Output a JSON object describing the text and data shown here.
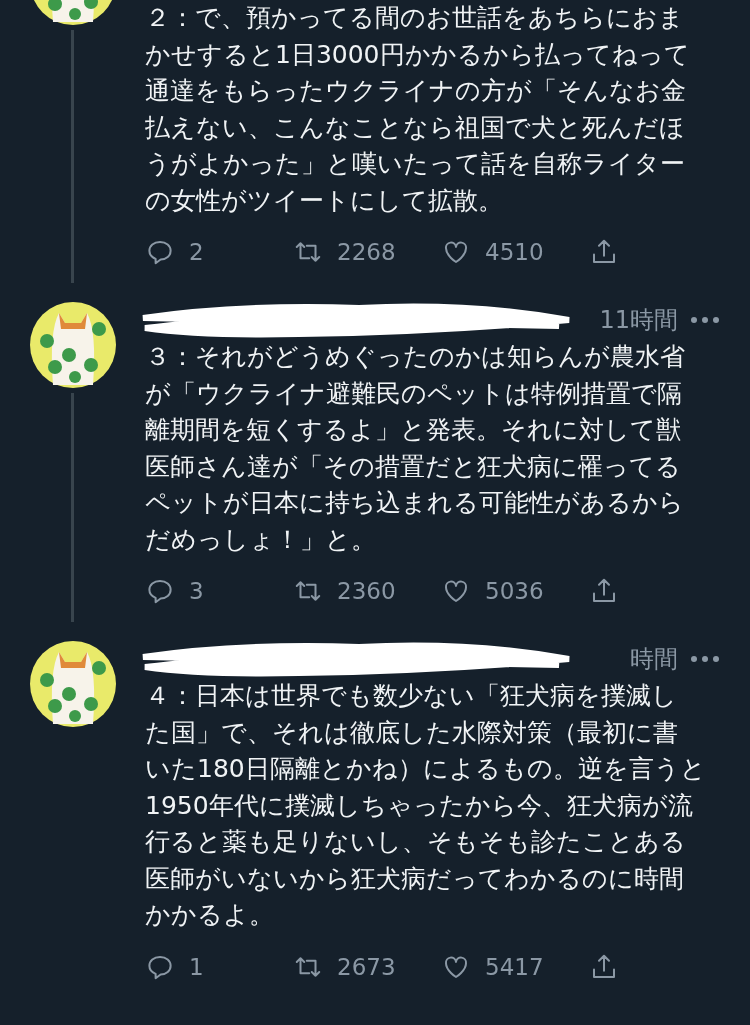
{
  "tweets": [
    {
      "kind": "cut",
      "lines": [
        "２：で、預かってる間のお世話をあちらにおま",
        "かせすると1日3000円かかるから払ってねって",
        "通達をもらったウクライナの方が「そんなお金",
        "払えない、こんなことなら祖国で犬と死んだほ",
        "うがよかった」と嘆いたって話を自称ライター",
        "の女性がツイートにして拡散。"
      ],
      "replies": "2",
      "retweets": "2268",
      "likes": "4510"
    },
    {
      "kind": "full",
      "time": "11時間",
      "lines": [
        "３：それがどうめぐったのかは知らんが農水省",
        "が「ウクライナ避難民のペットは特例措置で隔",
        "離期間を短くするよ」と発表。それに対して獣",
        "医師さん達が「その措置だと狂犬病に罹ってる",
        "ペットが日本に持ち込まれる可能性があるから",
        "だめっしょ！」と。"
      ],
      "replies": "3",
      "retweets": "2360",
      "likes": "5036"
    },
    {
      "kind": "full",
      "time": "時間",
      "lines": [
        "４：日本は世界でも数少ない「狂犬病を撲滅し",
        "た国」で、それは徹底した水際対策（最初に書",
        "いた180日隔離とかね）によるもの。逆を言うと",
        "1950年代に撲滅しちゃったから今、狂犬病が流",
        "行ると薬も足りないし、そもそも診たことある",
        "医師がいないから狂犬病だってわかるのに時間",
        "かかるよ。"
      ],
      "replies": "1",
      "retweets": "2673",
      "likes": "5417"
    }
  ]
}
